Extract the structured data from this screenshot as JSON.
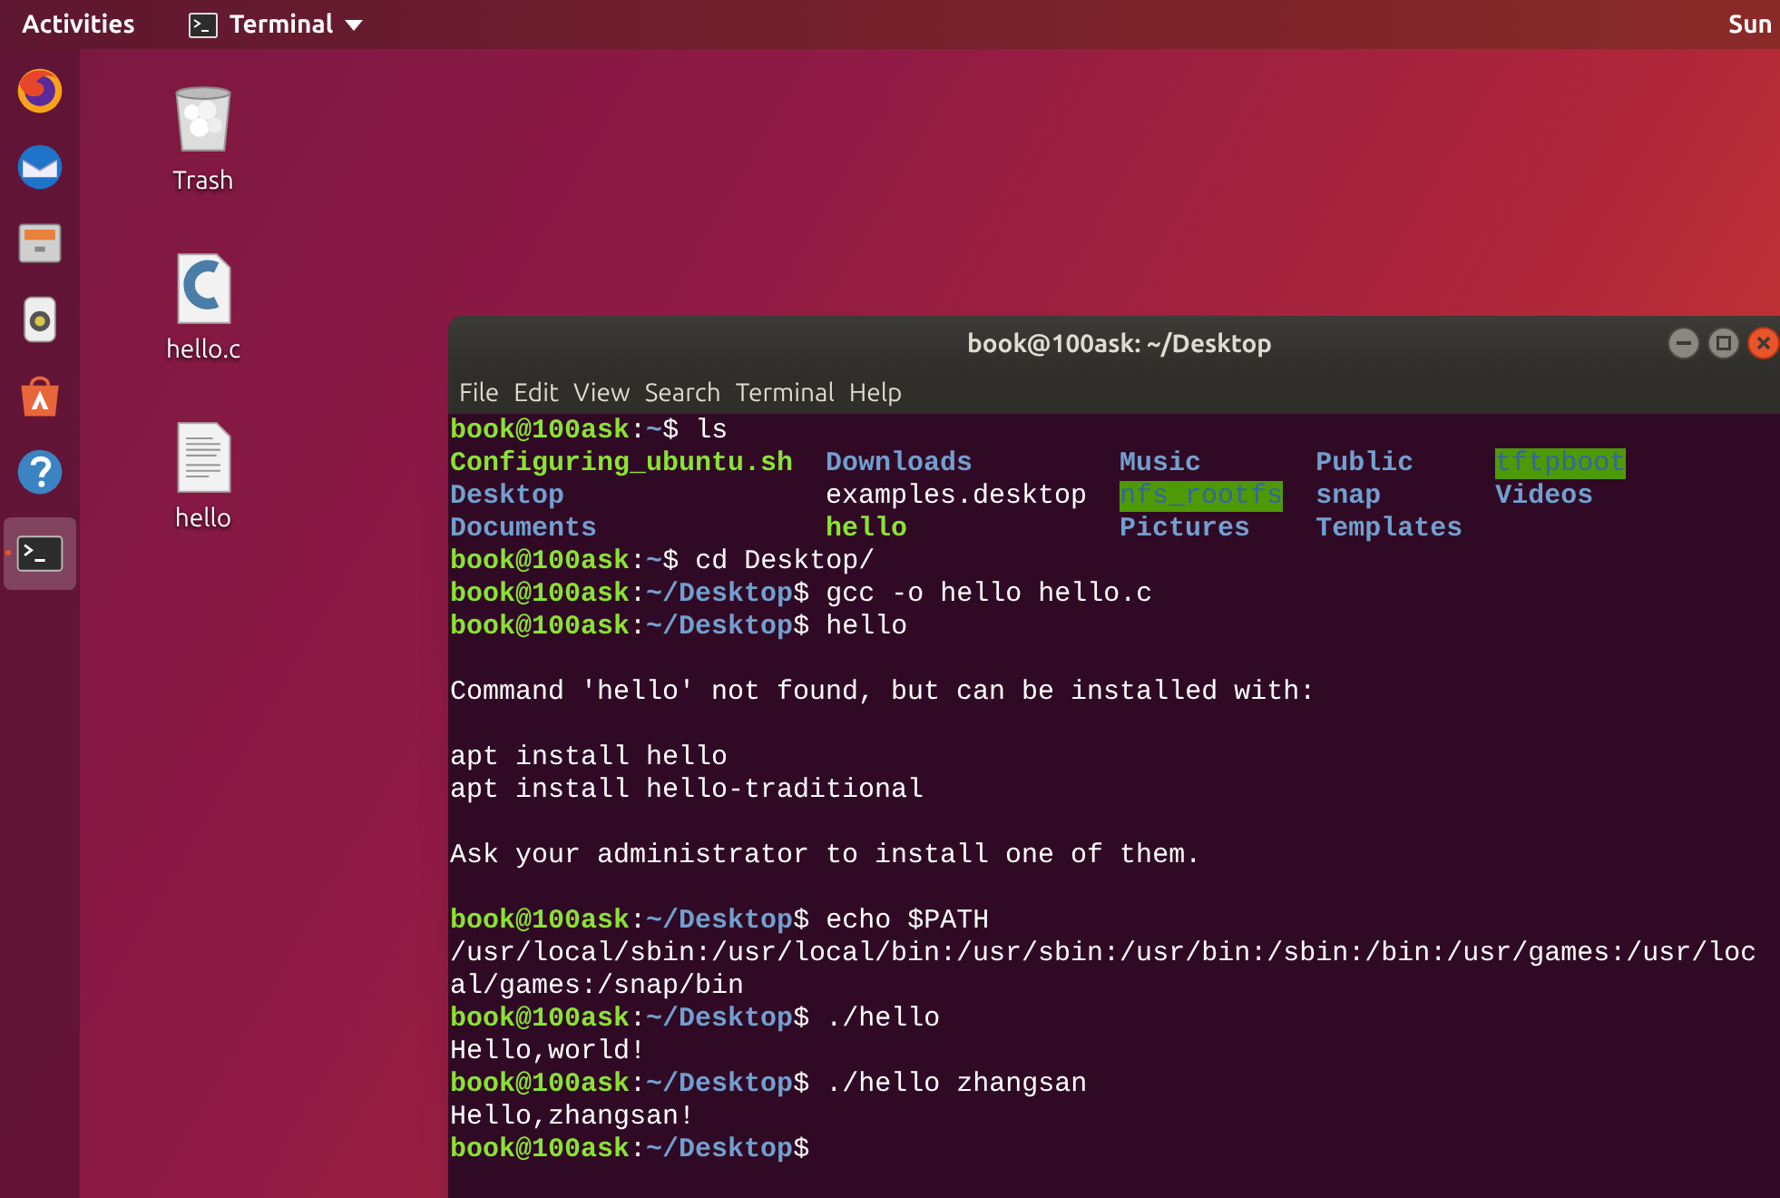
{
  "top_bar": {
    "activities": "Activities",
    "app_menu": "Terminal",
    "clock": "Sun"
  },
  "dock": [
    {
      "kind": "browser",
      "selected": false
    },
    {
      "kind": "mail",
      "selected": false
    },
    {
      "kind": "files",
      "selected": false
    },
    {
      "kind": "music",
      "selected": false
    },
    {
      "kind": "software",
      "selected": false
    },
    {
      "kind": "help",
      "selected": false
    },
    {
      "kind": "terminal",
      "selected": true
    }
  ],
  "desktop_icons": [
    {
      "kind": "trash",
      "label": "Trash"
    },
    {
      "kind": "source",
      "label": "hello.c"
    },
    {
      "kind": "document",
      "label": "hello"
    }
  ],
  "window": {
    "title": "book@100ask: ~/Desktop",
    "menu": [
      "File",
      "Edit",
      "View",
      "Search",
      "Terminal",
      "Help"
    ],
    "lines": [
      {
        "kind": "prompt",
        "user": "book@100ask",
        "sep": ":",
        "path": "~",
        "dollar": "$",
        "command": "ls"
      },
      {
        "kind": "ls_row",
        "cells": [
          {
            "kind": "exec",
            "text": "Configuring_ubuntu.sh"
          },
          {
            "kind": "dir",
            "text": "Downloads"
          },
          {
            "kind": "dir",
            "text": "Music"
          },
          {
            "kind": "dir",
            "text": "Public"
          },
          {
            "kind": "dir_hl",
            "text": "tftpboot"
          }
        ]
      },
      {
        "kind": "ls_row",
        "cells": [
          {
            "kind": "dir",
            "text": "Desktop"
          },
          {
            "kind": "file",
            "text": "examples.desktop"
          },
          {
            "kind": "dir_hl",
            "text": "nfs_rootfs"
          },
          {
            "kind": "dir",
            "text": "snap"
          },
          {
            "kind": "dir",
            "text": "Videos"
          }
        ]
      },
      {
        "kind": "ls_row",
        "cells": [
          {
            "kind": "dir",
            "text": "Documents"
          },
          {
            "kind": "exec",
            "text": "hello"
          },
          {
            "kind": "dir",
            "text": "Pictures"
          },
          {
            "kind": "dir",
            "text": "Templates"
          }
        ]
      },
      {
        "kind": "prompt",
        "user": "book@100ask",
        "sep": ":",
        "path": "~",
        "dollar": "$",
        "command": "cd Desktop/"
      },
      {
        "kind": "prompt",
        "user": "book@100ask",
        "sep": ":",
        "path": "~/Desktop",
        "dollar": "$",
        "command": "gcc -o hello hello.c"
      },
      {
        "kind": "prompt",
        "user": "book@100ask",
        "sep": ":",
        "path": "~/Desktop",
        "dollar": "$",
        "command": "hello"
      },
      {
        "kind": "blank"
      },
      {
        "kind": "output",
        "text": "Command 'hello' not found, but can be installed with:"
      },
      {
        "kind": "blank"
      },
      {
        "kind": "output",
        "text": "apt install hello"
      },
      {
        "kind": "output",
        "text": "apt install hello-traditional"
      },
      {
        "kind": "blank"
      },
      {
        "kind": "output",
        "text": "Ask your administrator to install one of them."
      },
      {
        "kind": "blank"
      },
      {
        "kind": "prompt",
        "user": "book@100ask",
        "sep": ":",
        "path": "~/Desktop",
        "dollar": "$",
        "command": "echo $PATH"
      },
      {
        "kind": "output",
        "text": "/usr/local/sbin:/usr/local/bin:/usr/sbin:/usr/bin:/sbin:/bin:/usr/games:/usr/loc"
      },
      {
        "kind": "output",
        "text": "al/games:/snap/bin"
      },
      {
        "kind": "prompt",
        "user": "book@100ask",
        "sep": ":",
        "path": "~/Desktop",
        "dollar": "$",
        "command": "./hello"
      },
      {
        "kind": "output",
        "text": "Hello,world!"
      },
      {
        "kind": "prompt",
        "user": "book@100ask",
        "sep": ":",
        "path": "~/Desktop",
        "dollar": "$",
        "command": "./hello zhangsan"
      },
      {
        "kind": "output",
        "text": "Hello,zhangsan!"
      },
      {
        "kind": "prompt",
        "user": "book@100ask",
        "sep": ":",
        "path": "~/Desktop",
        "dollar": "$"
      }
    ]
  }
}
